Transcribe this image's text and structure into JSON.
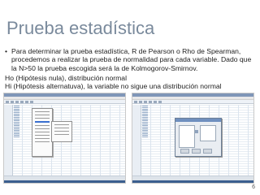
{
  "slide": {
    "title": "Prueba estadística",
    "bullet": "Para determinar la prueba estadística, R de Pearson o Rho de Spearman, procedemos a realizar la prueba de normalidad para cada variable. Dado que la N>50 la prueba escogida será la de Kolmogorov-Smirnov.",
    "bullet_marker": "•",
    "h0": "Ho (Hipótesis nula), distribución normal",
    "hi": "Hi (Hipótesis alternatuva), la variable no sigue una distribución normal",
    "page_number": "6"
  },
  "colors": {
    "title": "#7a8a9c",
    "text": "#222222"
  }
}
